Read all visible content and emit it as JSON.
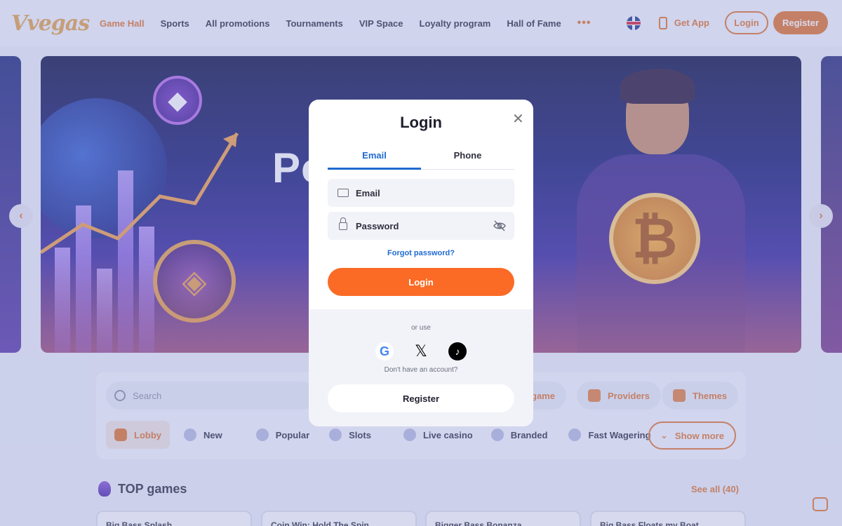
{
  "header": {
    "logo": "Vvegas",
    "nav": [
      "Game Hall",
      "Sports",
      "All promotions",
      "Tournaments",
      "VIP Space",
      "Loyalty program",
      "Hall of Fame"
    ],
    "more": "•••",
    "get_app": "Get App",
    "login": "Login",
    "register": "Register"
  },
  "hero": {
    "title": "Po            o •"
  },
  "filters": {
    "search_placeholder": "Search",
    "pills": [
      "game",
      "Providers",
      "Themes"
    ],
    "categories": [
      "Lobby",
      "New",
      "Popular",
      "Slots",
      "Live casino",
      "Branded",
      "Fast Wagering"
    ],
    "show_more": "Show more"
  },
  "top_games": {
    "title": "TOP games",
    "see_all": "See all (40)",
    "cards": [
      "Big Bass Splash",
      "Coin Win: Hold The Spin",
      "Bigger Bass Bonanza",
      "Big Bass Floats my Boat"
    ]
  },
  "modal": {
    "title": "Login",
    "close": "✕",
    "tabs": [
      "Email",
      "Phone"
    ],
    "email_label": "Email",
    "password_label": "Password",
    "forgot": "Forgot password?",
    "login_button": "Login",
    "or_use": "or use",
    "no_account": "Don't have an account?",
    "register_button": "Register"
  },
  "colors": {
    "accent": "#e2762e",
    "login_button": "#fb6b26",
    "tab_active": "#1f6ad0"
  },
  "icons": {
    "social": [
      "google-icon",
      "x-icon",
      "tiktok-icon"
    ]
  }
}
